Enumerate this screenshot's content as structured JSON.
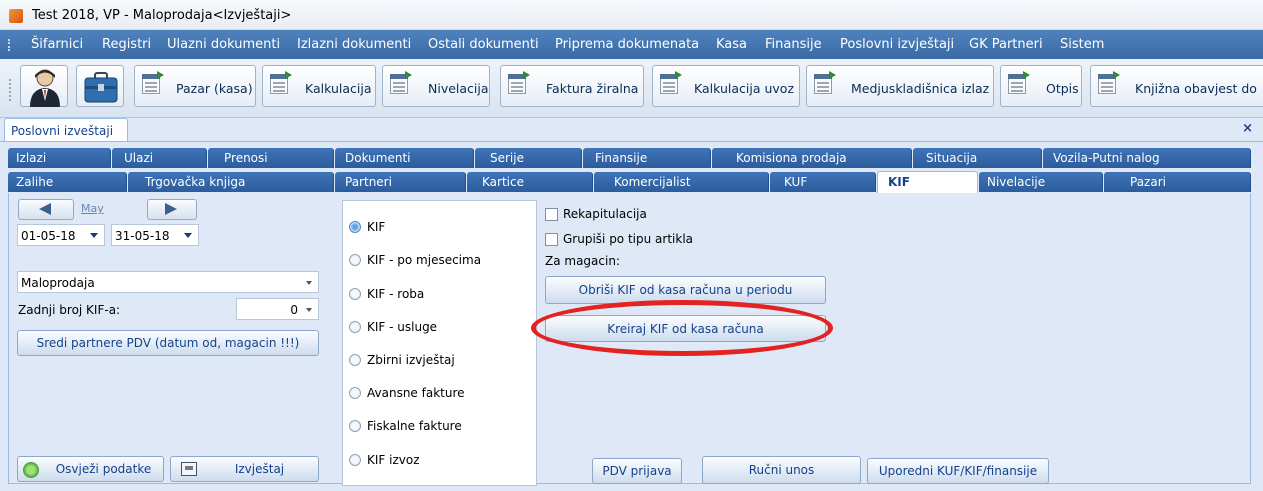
{
  "window": {
    "title": "Test 2018, VP - Maloprodaja<Izvještaji>"
  },
  "menu": [
    "Šifarnici",
    "Registri",
    "Ulazni dokumenti",
    "Izlazni dokumenti",
    "Ostali dokumenti",
    "Priprema dokumenata",
    "Kasa",
    "Finansije",
    "Poslovni izvještaji",
    "GK Partneri",
    "Sistem"
  ],
  "toolbar": {
    "icons": [
      "user-icon",
      "briefcase-icon"
    ],
    "buttons": [
      "Pazar (kasa)",
      "Kalkulacija",
      "Nivelacija",
      "Faktura žiralna",
      "Kalkulacija uvoz",
      "Medjuskladišnica izlaz",
      "Otpis",
      "Knjižna obavjest do"
    ]
  },
  "workspace_tab": {
    "label": "Poslovni izveštaji",
    "close": "×"
  },
  "tabs_row1": [
    "Izlazi",
    "Ulazi",
    "Prenosi",
    "Dokumenti",
    "Serije",
    "Finansije",
    "Komisiona prodaja",
    "Situacija",
    "Vozila-Putni nalog"
  ],
  "tabs_row2": [
    "Zalihe",
    "Trgovačka knjiga",
    "Partneri",
    "Kartice",
    "Komercijalist",
    "KUF",
    "KIF",
    "Nivelacije",
    "Pazari"
  ],
  "active_tab": "KIF",
  "left": {
    "month": "May",
    "date_from": "01-05-18",
    "date_to": "31-05-18",
    "store": "Maloprodaja",
    "last_kif_label": "Zadnji broj KIF-a:",
    "last_kif_value": "0",
    "fix_partners_button": "Sredi partnere PDV (datum od, magacin !!!)",
    "refresh_button": "Osvježi podatke",
    "report_button": "Izvještaj"
  },
  "radios": {
    "selected": "KIF",
    "options": [
      "KIF",
      "KIF - po mjesecima",
      "KIF - roba",
      "KIF - usluge",
      "Zbirni izvještaj",
      "Avansne fakture",
      "Fiskalne fakture",
      "KIF izvoz"
    ]
  },
  "right": {
    "recap_label": "Rekapitulacija",
    "group_label": "Grupiši po tipu artikla",
    "warehouse_label": "Za magacin:",
    "delete_button": "Obriši KIF od kasa računa u periodu",
    "create_button": "Kreiraj KIF od kasa računa",
    "pdv_button": "PDV prijava",
    "manual_button": "Ručni unos",
    "compare_button": "Uporedni KUF/KIF/finansije"
  },
  "colors": {
    "menu_bar": "#3f72b3",
    "tab": "#356aae",
    "highlight": "#e32222",
    "panel_bg": "#dfe8f6"
  }
}
